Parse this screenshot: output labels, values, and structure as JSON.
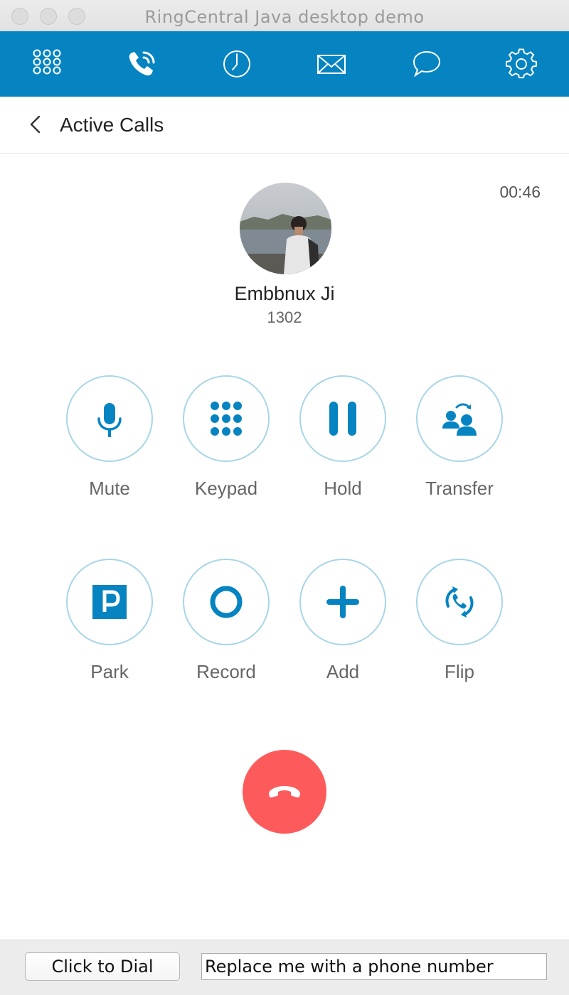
{
  "window": {
    "title": "RingCentral Java desktop demo"
  },
  "navbar": {
    "items": [
      {
        "icon": "dialpad-icon"
      },
      {
        "icon": "active-call-icon"
      },
      {
        "icon": "history-clock-icon"
      },
      {
        "icon": "messages-envelope-icon"
      },
      {
        "icon": "chat-bubble-icon"
      },
      {
        "icon": "settings-gear-icon"
      }
    ],
    "colors": {
      "background": "#0684c2",
      "icon": "#ffffff"
    }
  },
  "header": {
    "title": "Active Calls",
    "back_icon": "chevron-left-icon"
  },
  "call": {
    "timer": "00:46",
    "caller_name": "Embbnux Ji",
    "caller_ext": "1302"
  },
  "actions": [
    {
      "label": "Mute",
      "icon": "microphone-icon"
    },
    {
      "label": "Keypad",
      "icon": "keypad-icon"
    },
    {
      "label": "Hold",
      "icon": "pause-icon"
    },
    {
      "label": "Transfer",
      "icon": "transfer-icon"
    },
    {
      "label": "Park",
      "icon": "park-icon"
    },
    {
      "label": "Record",
      "icon": "record-icon"
    },
    {
      "label": "Add",
      "icon": "plus-icon"
    },
    {
      "label": "Flip",
      "icon": "flip-icon"
    }
  ],
  "end_call": {
    "icon": "hangup-icon",
    "color": "#fd5b5b"
  },
  "accent_color": "#0684c2",
  "bottom": {
    "dial_button": "Click to Dial",
    "phone_input_value": "Replace me with a phone number"
  }
}
